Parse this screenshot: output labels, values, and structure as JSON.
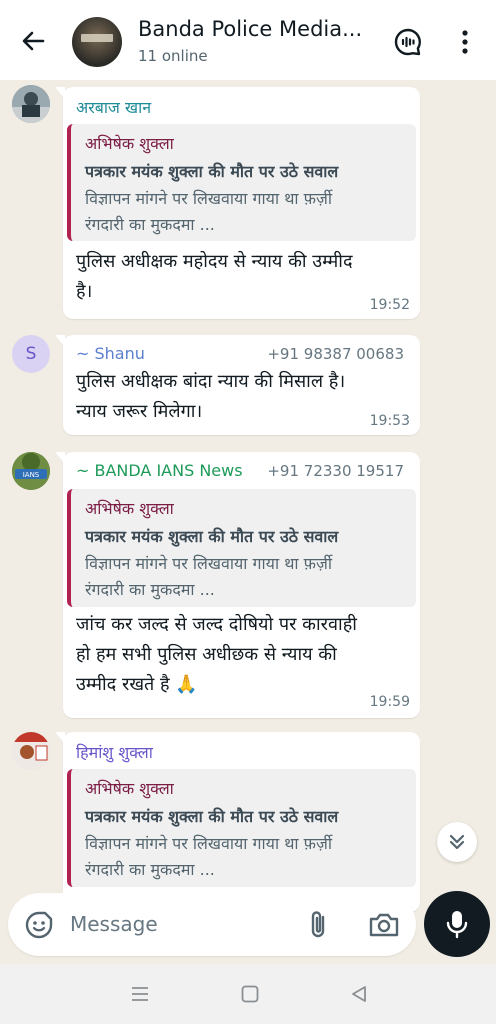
{
  "header": {
    "title": "Banda Police Media...",
    "subtitle": "11 online"
  },
  "composer": {
    "placeholder": "Message"
  },
  "messages": [
    {
      "sender": "अरबाज खान",
      "sender_color": "#1f8b98",
      "phone": "",
      "quote": {
        "name": "अभिषेक शुक्ला",
        "title": "पत्रकार मयंक शुक्ला की मौत पर उठे सवाल",
        "line1": "विज्ञापन मांगने पर लिखवाया गाया था फ़र्ज़ी",
        "line2": "रंगदारी का मुकदमा ..."
      },
      "text_lines": [
        "पुलिस अधीक्षक महोदय से न्याय की उम्मीद",
        "है।"
      ],
      "time": "19:52"
    },
    {
      "sender": "~ Shanu",
      "sender_color": "#5b7fce",
      "avatar_letter": "S",
      "phone": "+91 98387 00683",
      "text_lines": [
        "पुलिस अधीक्षक बांदा  न्याय की मिसाल है।",
        "न्याय जरूर मिलेगा।"
      ],
      "time": "19:53"
    },
    {
      "sender": "~ BANDA IANS News",
      "sender_color": "#1e9a58",
      "phone": "+91 72330 19517",
      "avatar_text": "IANS",
      "quote": {
        "name": "अभिषेक शुक्ला",
        "title": "पत्रकार मयंक शुक्ला की मौत पर उठे सवाल",
        "line1": "विज्ञापन मांगने पर लिखवाया गाया था फ़र्ज़ी",
        "line2": "रंगदारी का मुकदमा ..."
      },
      "text_lines": [
        "जांच कर जल्द से जल्द दोषियो पर कारवाही",
        "हो हम सभी पुलिस अधीछक से  न्याय की",
        "उम्मीद रखते है 🙏"
      ],
      "time": "19:59"
    },
    {
      "sender": "हिमांशु शुक्ला",
      "sender_color": "#6a54c9",
      "phone": "",
      "quote": {
        "name": "अभिषेक शुक्ला",
        "title": "पत्रकार मयंक शुक्ला की मौत पर उठे सवाल",
        "line1": "विज्ञापन मांगने पर लिखवाया गाया था फ़र्ज़ी",
        "line2": "रंगदारी का मुकदमा ..."
      }
    }
  ],
  "icons": {
    "back": "arrow-left-icon",
    "call": "voice-chat-icon",
    "menu": "more-vert-icon",
    "emoji": "sticker-icon",
    "attach": "paperclip-icon",
    "camera": "camera-icon",
    "mic": "mic-icon",
    "scroll": "double-chevron-down-icon"
  },
  "colors": {
    "quote_bar": "#b0224f",
    "chat_bg": "#f2ede4",
    "mic_bg": "#111b21"
  }
}
